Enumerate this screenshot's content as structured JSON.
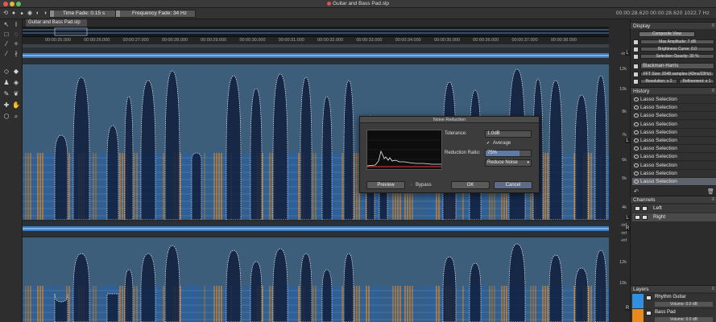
{
  "window": {
    "title": "Guitar and Bass Pad.slp"
  },
  "toolbar": {
    "time_fade_label": "Time Fade: 0.15 s",
    "frequency_fade_label": "Frequency Fade: 34 Hz",
    "clock": "00:00:28.620  00:00:28.620  1022.7 Hz"
  },
  "file_tab": {
    "label": "Guitar and Bass Pad.slp"
  },
  "ruler": {
    "ticks": [
      "00:00:25.000",
      "00:00:26.000",
      "00:00:27.000",
      "00:00:28.000",
      "00:00:29.000",
      "00:00:30.000",
      "00:00:31.000",
      "00:00:32.000",
      "00:00:33.000",
      "00:00:34.000",
      "00:00:35.000",
      "00:00:36.000",
      "00:00:37.000",
      "00:00:38.000"
    ]
  },
  "channels_view": {
    "wave_db_labels": [
      "-inf",
      "-inf",
      "-inf",
      "-inf"
    ],
    "freq_labels_top": [
      "12k",
      "10k",
      "8k",
      "7k",
      "6k",
      "5k",
      "4k"
    ],
    "freq_labels_bottom": [
      "12k",
      "10k"
    ],
    "channel_letters": [
      "L",
      "L",
      "L",
      "R",
      "R"
    ]
  },
  "dialog": {
    "title": "Noise Reduction",
    "tolerance_label": "Tolerance:",
    "tolerance_value": "1.0dB",
    "average_label": "Average",
    "average_checked": true,
    "reduction_ratio_label": "Reduction Ratio:",
    "reduction_ratio_value": "75%",
    "reduction_ratio_fraction": 0.75,
    "mode_value": "Reduce Noise",
    "preview_label": "Preview",
    "bypass_label": "Bypass",
    "ok_label": "OK",
    "cancel_label": "Cancel"
  },
  "display_panel": {
    "title": "Display",
    "composite_view_label": "Composite View",
    "max_amplitude_label": "Max Amplitude: 7 dB",
    "brightness_label": "Brightness Curve: 0.0",
    "selection_opacity_label": "Selection Opacity: 30 %",
    "window_type": "Blackman-Harris",
    "fft_label": "FFT Size: 2048 samples (43ms/23Hz)",
    "resolution_label": "Resolution: x 2",
    "refinement_label": "Refinement: x 1"
  },
  "history_panel": {
    "title": "History",
    "items": [
      "Lasso Selection",
      "Lasso Selection",
      "Lasso Selection",
      "Lasso Selection",
      "Lasso Selection",
      "Lasso Selection",
      "Lasso Selection",
      "Lasso Selection",
      "Lasso Selection",
      "Lasso Selection",
      "Lasso Selection"
    ],
    "selected_index": 10
  },
  "channels_panel": {
    "title": "Channels",
    "items": [
      "Left",
      "Right"
    ]
  },
  "layers_panel": {
    "title": "Layers",
    "layers": [
      {
        "name": "Rhythm Guitar",
        "volume": "Volume: 0.0 dB",
        "color": "#2f8fe0"
      },
      {
        "name": "Bass Pad",
        "volume": "Volume: 0.0 dB",
        "color": "#e88a1c"
      }
    ]
  },
  "colors": {
    "spectrogram_bg": "#3c5e7a",
    "spectrogram_high": "#1f63b8",
    "spectrogram_low": "#c08040",
    "selection_outline": "#f2f2f2",
    "accent": "#5e6a86"
  }
}
